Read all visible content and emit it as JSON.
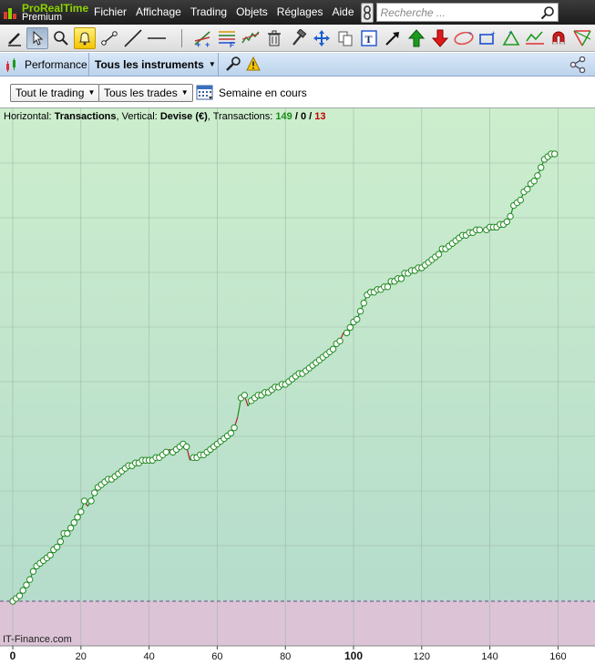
{
  "app": {
    "logo_line1": "ProRealTime",
    "logo_line2": "Premium"
  },
  "menu": [
    "Fichier",
    "Affichage",
    "Trading",
    "Objets",
    "Réglages",
    "Aide"
  ],
  "search": {
    "placeholder": "Recherche ..."
  },
  "toolbar": {
    "icons": [
      "pencil-icon",
      "cursor-icon",
      "zoom-icon",
      "alert-bell-icon",
      "segment-tool-icon",
      "line-tool-icon",
      "horizontal-line-icon",
      "indicators-icon",
      "fibonacci-icon",
      "trend-lines-icon",
      "trash-icon",
      "hammer-icon",
      "move-icon",
      "copy-icon",
      "text-tool-icon",
      "arrow-tool-icon",
      "up-arrow-icon",
      "down-arrow-icon",
      "ellipse-tool-icon",
      "rectangle-tool-icon",
      "triangle-tool-icon",
      "trend-channel-icon",
      "magnet-icon",
      "gann-fan-icon"
    ]
  },
  "tabs": {
    "performance": "Performance",
    "instruments": "Tous les instruments"
  },
  "filters": {
    "trading": "Tout le trading",
    "trades": "Tous les trades",
    "period": "Semaine en cours"
  },
  "chart_info": {
    "h_label": "Horizontal:",
    "h_value": "Transactions",
    "v_label": ", Vertical:",
    "v_value": "Devise (€)",
    "t_label": ", Transactions:",
    "win": "149",
    "sep1": " / ",
    "neutral": "0",
    "sep2": " / ",
    "loss": "13"
  },
  "watermark": "IT-Finance.com",
  "colors": {
    "positive_zone_top": "#cdeecd",
    "positive_zone_bottom": "#b5dccc",
    "negative_zone": "#dcc3d6",
    "line_up": "#1f8a1f",
    "line_down": "#b22222",
    "zero_line": "#6a4a8a"
  },
  "chart_data": {
    "type": "line",
    "title": "",
    "xlabel": "Transactions",
    "ylabel": "Devise (€)",
    "x_ticks": [
      0,
      20,
      40,
      60,
      80,
      100,
      120,
      140,
      160
    ],
    "highlighted_tick": 100,
    "xlim": [
      0,
      170
    ],
    "grid": true,
    "series": [
      {
        "values": [
          0,
          1,
          2,
          4,
          6,
          8,
          11,
          13,
          14,
          15,
          16,
          17,
          19,
          20,
          22,
          25,
          25,
          27,
          29,
          31,
          33,
          37,
          35,
          37,
          40,
          42,
          43,
          44,
          45,
          45,
          46,
          47,
          48,
          49,
          50,
          50,
          51,
          51,
          52,
          52,
          52,
          52,
          53,
          53,
          54,
          55,
          56,
          55,
          56,
          57,
          58,
          57,
          52,
          53,
          53,
          54,
          54,
          55,
          56,
          57,
          58,
          59,
          60,
          61,
          62,
          64,
          68,
          75,
          76,
          72,
          74,
          75,
          76,
          76,
          77,
          77,
          78,
          79,
          79,
          80,
          80,
          81,
          82,
          83,
          84,
          84,
          85,
          86,
          87,
          88,
          89,
          90,
          91,
          92,
          93,
          95,
          96,
          99,
          99,
          101,
          103,
          104,
          107,
          110,
          113,
          114,
          114,
          115,
          115,
          116,
          116,
          118,
          118,
          119,
          119,
          121,
          121,
          122,
          122,
          123,
          123,
          124,
          125,
          126,
          127,
          128,
          130,
          130,
          131,
          132,
          133,
          134,
          135,
          135,
          136,
          136,
          137,
          137,
          137,
          137,
          138,
          138,
          138,
          139,
          139,
          140,
          142,
          146,
          147,
          148,
          151,
          152,
          154,
          155,
          157,
          160,
          163,
          164,
          165,
          165
        ],
        "losing_trades": [
          22,
          46,
          52,
          66,
          69,
          97,
          138
        ]
      }
    ],
    "ylim_note": "unlabeled y-axis"
  }
}
